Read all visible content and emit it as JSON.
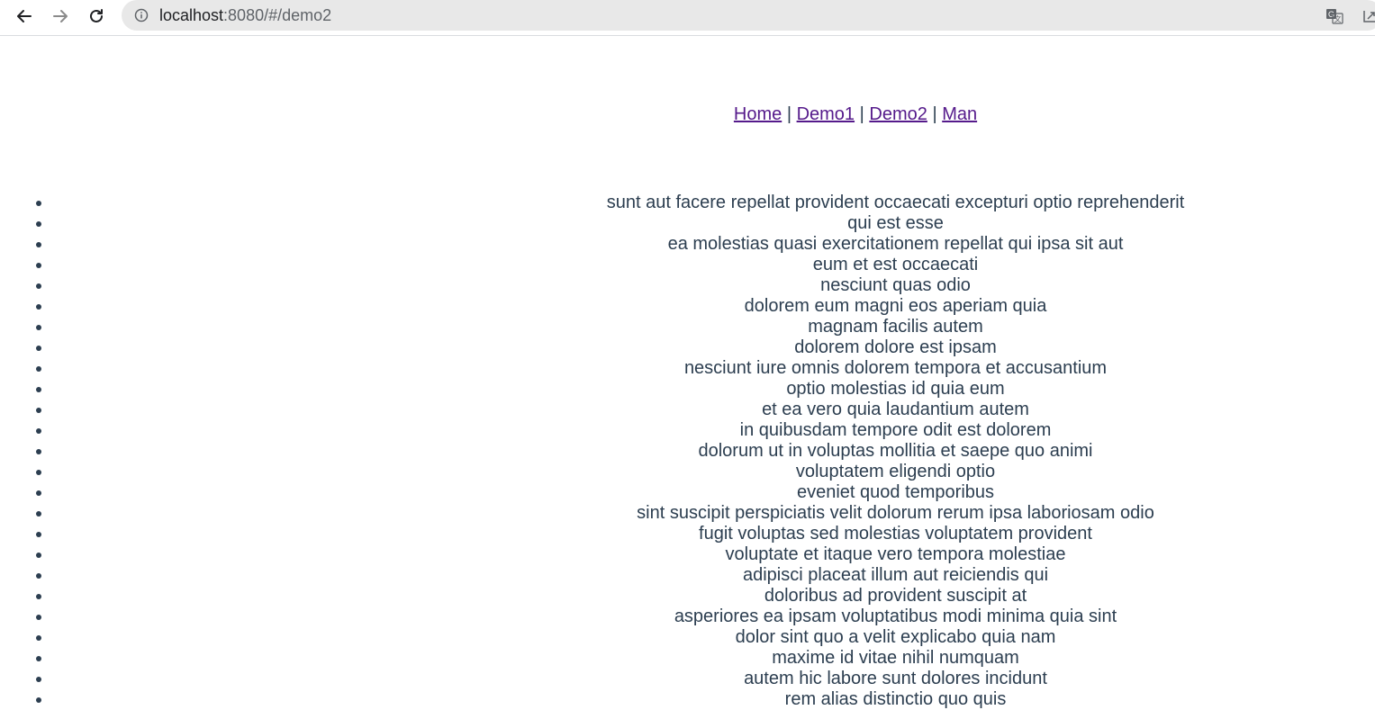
{
  "browser": {
    "url_host": "localhost",
    "url_rest": ":8080/#/demo2",
    "back_icon": "back-arrow-icon",
    "forward_icon": "forward-arrow-icon",
    "reload_icon": "reload-icon",
    "info_icon": "info-icon",
    "translate_icon": "translate-icon",
    "share_icon": "share-icon"
  },
  "nav": {
    "links": [
      "Home",
      "Demo1",
      "Demo2",
      "Man"
    ],
    "separator": "|",
    "link_color": "#551a8b"
  },
  "posts": [
    "sunt aut facere repellat provident occaecati excepturi optio reprehenderit",
    "qui est esse",
    "ea molestias quasi exercitationem repellat qui ipsa sit aut",
    "eum et est occaecati",
    "nesciunt quas odio",
    "dolorem eum magni eos aperiam quia",
    "magnam facilis autem",
    "dolorem dolore est ipsam",
    "nesciunt iure omnis dolorem tempora et accusantium",
    "optio molestias id quia eum",
    "et ea vero quia laudantium autem",
    "in quibusdam tempore odit est dolorem",
    "dolorum ut in voluptas mollitia et saepe quo animi",
    "voluptatem eligendi optio",
    "eveniet quod temporibus",
    "sint suscipit perspiciatis velit dolorum rerum ipsa laboriosam odio",
    "fugit voluptas sed molestias voluptatem provident",
    "voluptate et itaque vero tempora molestiae",
    "adipisci placeat illum aut reiciendis qui",
    "doloribus ad provident suscipit at",
    "asperiores ea ipsam voluptatibus modi minima quia sint",
    "dolor sint quo a velit explicabo quia nam",
    "maxime id vitae nihil numquam",
    "autem hic labore sunt dolores incidunt",
    "rem alias distinctio quo quis"
  ],
  "colors": {
    "text": "#2c3e50",
    "omnibox_bg": "#e8e8e8"
  }
}
